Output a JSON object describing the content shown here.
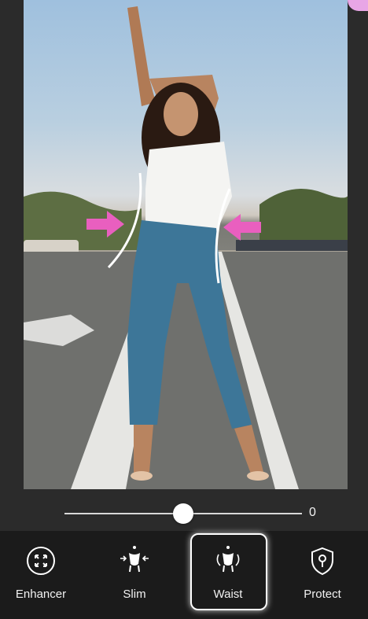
{
  "slider": {
    "value": "0",
    "level_fraction": 0.45
  },
  "tools": [
    {
      "label": "Enhancer",
      "icon": "enhancer-icon",
      "active": false
    },
    {
      "label": "Slim",
      "icon": "slim-icon",
      "active": false
    },
    {
      "label": "Waist",
      "icon": "waist-icon",
      "active": true
    },
    {
      "label": "Protect",
      "icon": "protect-icon",
      "active": false
    }
  ],
  "colors": {
    "accent_pink": "#e95fbf",
    "toolbar_bg": "#1b1b1b",
    "background": "#2b2b2b"
  }
}
